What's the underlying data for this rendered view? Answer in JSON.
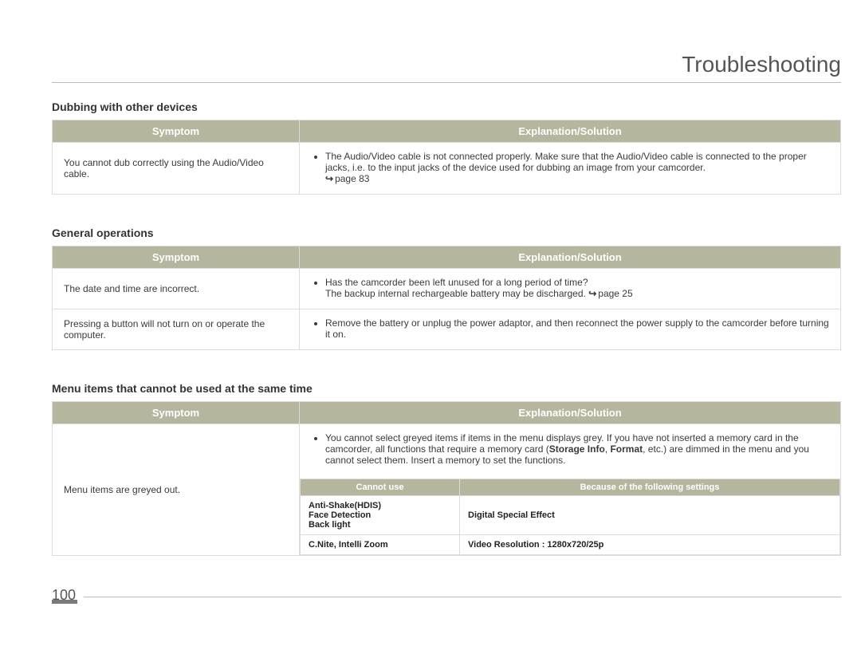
{
  "page_title": "Troubleshooting",
  "page_number": "100",
  "col_symptom": "Symptom",
  "col_explanation": "Explanation/Solution",
  "sections": {
    "dubbing": {
      "heading": "Dubbing with other devices",
      "rows": [
        {
          "symptom": "You cannot dub correctly using the Audio/Video cable.",
          "explanation_pre": "The Audio/Video cable is not connected properly. Make sure that the Audio/Video cable is connected to the proper jacks, i.e. to the input jacks of the device used for dubbing an image from your camcorder. ",
          "pageref": "page 83"
        }
      ]
    },
    "general": {
      "heading": "General operations",
      "rows": [
        {
          "symptom": "The date and time are incorrect.",
          "explanation_pre": "Has the camcorder been left unused for a long period of time?",
          "explanation_post": "The backup internal rechargeable battery may be discharged. ",
          "pageref": "page 25"
        },
        {
          "symptom": "Pressing a button will not turn on or operate the computer.",
          "explanation_pre": "Remove the battery or unplug the power adaptor, and then reconnect the power supply to the camcorder before turning it on."
        }
      ]
    },
    "menu": {
      "heading": "Menu items that cannot be used at the same time",
      "symptom": "Menu items are greyed out.",
      "explanation_text": "You cannot select greyed items if items in the menu displays grey. If you have not inserted a memory card in the camcorder, all functions that require a memory card (",
      "explanation_bold1": "Storage Info",
      "explanation_sep": ", ",
      "explanation_bold2": "Format",
      "explanation_tail": ", etc.) are dimmed in the menu and you cannot select them.  Insert a memory to set the functions.",
      "inner_headers": {
        "c1": "Cannot use",
        "c2": "Because of the following settings"
      },
      "inner_rows": [
        {
          "c1_line1": "Anti-Shake(HDIS)",
          "c1_line2": "Face Detection",
          "c1_line3": "Back light",
          "c2": "Digital Special Effect"
        },
        {
          "c1": "C.Nite, Intelli Zoom",
          "c2": "Video Resolution : 1280x720/25p"
        }
      ]
    }
  }
}
